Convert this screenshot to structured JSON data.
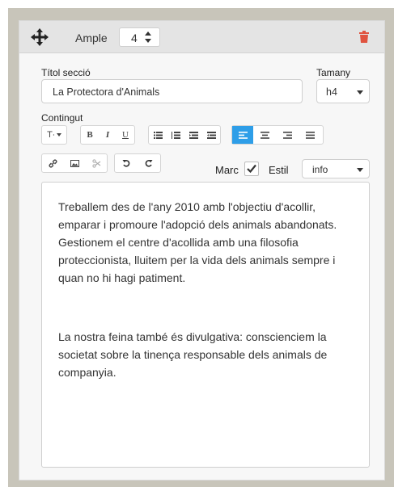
{
  "header": {
    "move_icon": "move-arrows-icon",
    "width_label": "Ample",
    "width_value": "4",
    "delete_icon": "trash-icon",
    "delete_color": "#e0533f"
  },
  "section_title": {
    "label": "Títol secció",
    "value": "La Protectora d'Animals"
  },
  "size": {
    "label": "Tamany",
    "value": "h4"
  },
  "content": {
    "label": "Contingut",
    "toolbar": {
      "font_size": "T∙",
      "bold": "B",
      "italic": "I",
      "underline": "U",
      "active_color": "#2e9ee8"
    },
    "frame_label": "Marc",
    "frame_checked": true,
    "style_label": "Estil",
    "style_value": "info",
    "paragraphs": [
      "Treballem des de l'any 2010 amb l'objectiu d'acollir, emparar i promoure l'adopció dels animals abandonats. Gestionem el centre d'acollida amb una filosofia proteccionista, lluitem per la vida dels animals sempre i quan no hi hagi patiment.",
      "La nostra feina també és divulgativa: conscienciem la societat sobre la tinença responsable dels animals de companyia."
    ]
  }
}
